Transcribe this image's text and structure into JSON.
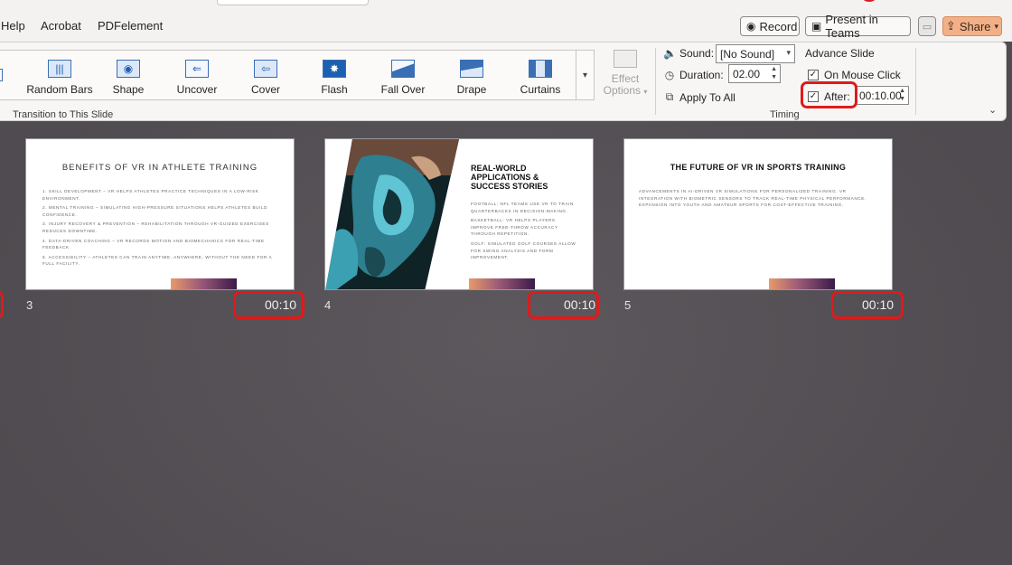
{
  "menu": {
    "items": [
      "Help",
      "Acrobat",
      "PDFelement"
    ],
    "record_label": "Record",
    "present_label": "Present in Teams",
    "share_label": "Share"
  },
  "ribbon": {
    "transitions": [
      {
        "label": "Random Bars",
        "icon": "random-bars-icon"
      },
      {
        "label": "Shape",
        "icon": "shape-icon"
      },
      {
        "label": "Uncover",
        "icon": "uncover-icon"
      },
      {
        "label": "Cover",
        "icon": "cover-icon"
      },
      {
        "label": "Flash",
        "icon": "flash-icon"
      },
      {
        "label": "Fall Over",
        "icon": "fall-over-icon"
      },
      {
        "label": "Drape",
        "icon": "drape-icon"
      },
      {
        "label": "Curtains",
        "icon": "curtains-icon"
      }
    ],
    "effect_options_line1": "Effect",
    "effect_options_line2": "Options",
    "transition_group_label": "Transition to This Slide",
    "timing": {
      "sound_label": "Sound:",
      "sound_value": "[No Sound]",
      "duration_label": "Duration:",
      "duration_value": "02.00",
      "apply_all_label": "Apply To All",
      "advance_title": "Advance Slide",
      "on_mouse_click_label": "On Mouse Click",
      "on_mouse_click_checked": true,
      "after_label": "After:",
      "after_checked": true,
      "after_value": "00:10.00",
      "group_label": "Timing"
    }
  },
  "slides": [
    {
      "number": "3",
      "time": "00:10",
      "title": "BENEFITS OF VR IN ATHLETE TRAINING",
      "bullets": [
        "1. Skill Development – VR helps athletes practice techniques in a low-risk environment.",
        "2. Mental Training – Simulating high-pressure situations helps athletes build confidence.",
        "3. Injury Recovery & Prevention – Rehabilitation through VR-guided exercises reduces downtime.",
        "4. Data-Driven Coaching – VR records motion and biomechanics for real-time feedback.",
        "5. Accessibility – Athletes can train anytime, anywhere, without the need for a full facility."
      ]
    },
    {
      "number": "4",
      "time": "00:10",
      "title_lines": [
        "REAL-WORLD",
        "APPLICATIONS &",
        "SUCCESS STORIES"
      ],
      "bullets": [
        "Football: NFL teams use VR to train quarterbacks in decision-making.",
        "Basketball: VR helps players improve free-throw accuracy through repetition.",
        "Golf: Simulated golf courses allow for swing analysis and form improvement."
      ]
    },
    {
      "number": "5",
      "time": "00:10",
      "title": "THE FUTURE OF VR IN SPORTS TRAINING",
      "body": "Advancements in AI-driven VR simulations for personalized training. VR integration with biometric sensors to track real-time physical performance. Expansion into youth and amateur sports for cost-effective training."
    }
  ],
  "colors": {
    "highlight": "#e01a1a",
    "share_bg": "#f3b086",
    "accent_blue": "#1d5fb0"
  }
}
